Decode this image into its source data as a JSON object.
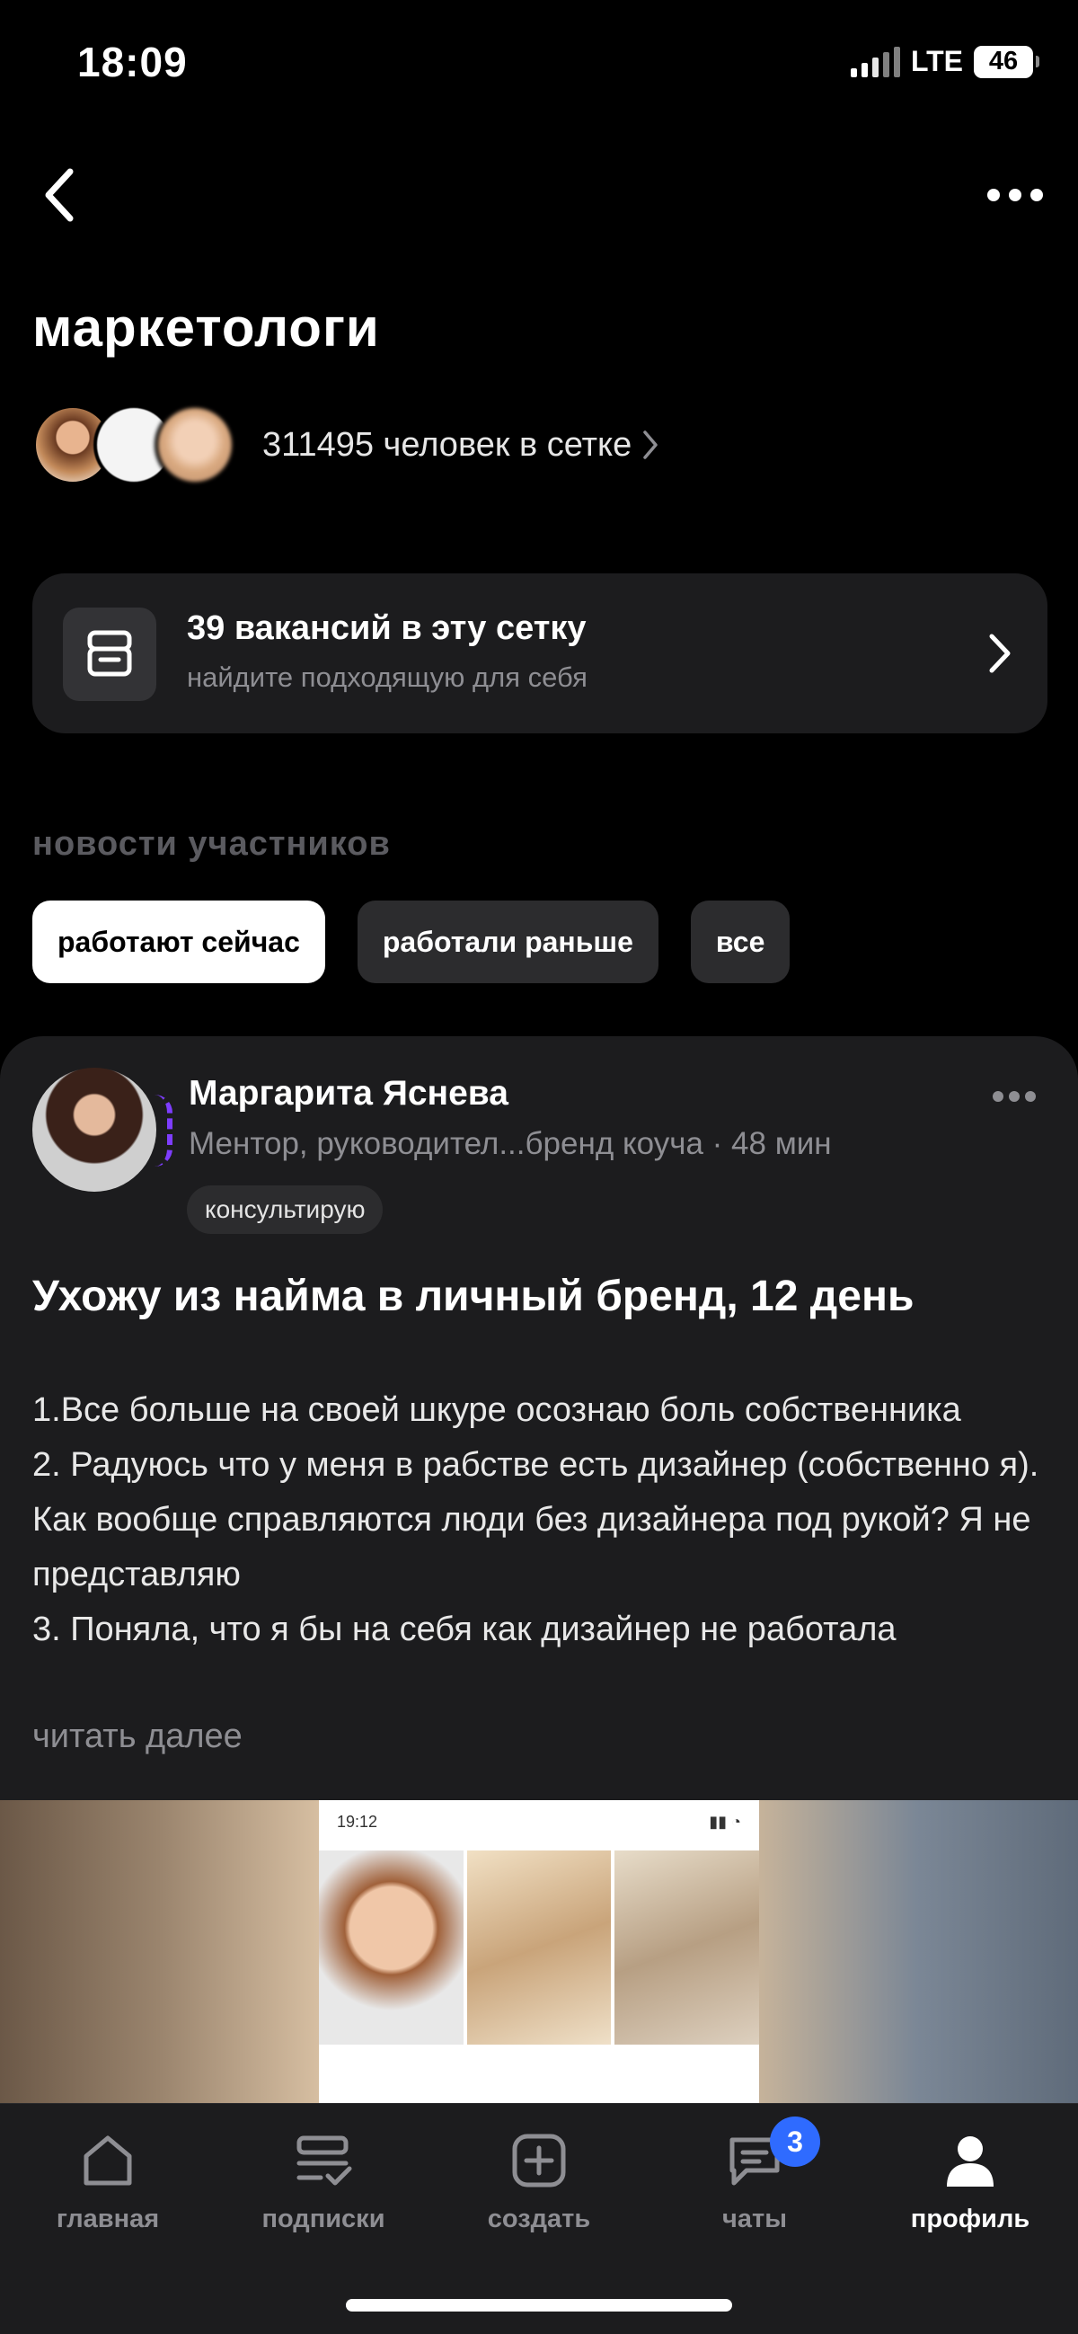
{
  "status_bar": {
    "time": "18:09",
    "network": "LTE",
    "battery": "46"
  },
  "header": {
    "title": "маркетологи"
  },
  "members": {
    "text": "311495 человек в сетке"
  },
  "vacancies": {
    "title": "39 вакансий в эту сетку",
    "subtitle": "найдите подходящую для себя"
  },
  "news": {
    "section_title": "новости участников",
    "filters": [
      "работают сейчас",
      "работали раньше",
      "все"
    ],
    "active_filter": "работают сейчас"
  },
  "post": {
    "author": "Маргарита Яснева",
    "meta": "Ментор, руководител...бренд коуча · 48 мин",
    "tag": "консультирую",
    "title": "Ухожу из найма в личный бренд, 12 день",
    "body_lines": [
      "1.Все больше на своей шкуре осознаю боль собственника",
      "2. Радуюсь что у меня в рабстве есть дизайнер (собственно я). Как вообще справляются люди без дизайнера под рукой? Я не представляю",
      "3. Поняла, что я бы на себя как дизайнер не работала"
    ],
    "read_more": "читать далее",
    "media_time": "19:12"
  },
  "tabbar": {
    "items": [
      {
        "label": "главная",
        "icon": "home-icon"
      },
      {
        "label": "подписки",
        "icon": "subscriptions-icon"
      },
      {
        "label": "создать",
        "icon": "create-icon"
      },
      {
        "label": "чаты",
        "icon": "chat-icon",
        "badge": "3"
      },
      {
        "label": "профиль",
        "icon": "profile-icon"
      }
    ],
    "active": "профиль"
  }
}
